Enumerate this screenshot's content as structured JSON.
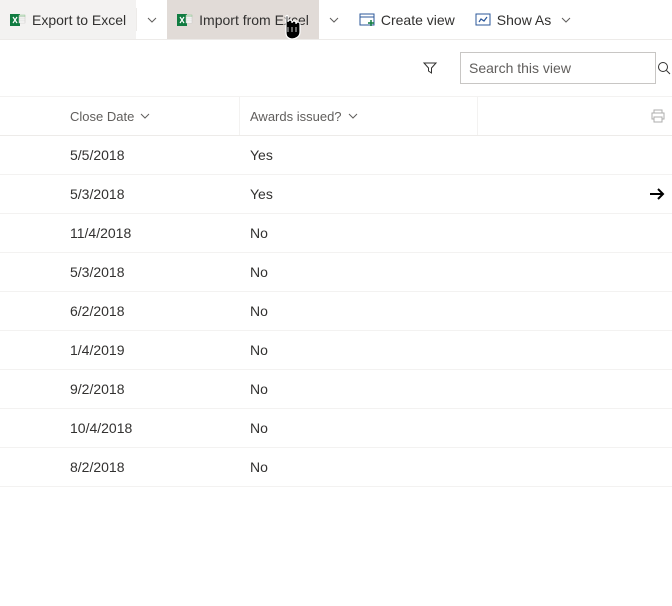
{
  "toolbar": {
    "export_label": "Export to Excel",
    "import_label": "Import from Excel",
    "create_view_label": "Create view",
    "show_as_label": "Show As"
  },
  "search": {
    "placeholder": "Search this view"
  },
  "columns": {
    "close_date": "Close Date",
    "awards_issued": "Awards issued?"
  },
  "rows": [
    {
      "close_date": "5/5/2018",
      "awards_issued": "Yes",
      "arrow": false
    },
    {
      "close_date": "5/3/2018",
      "awards_issued": "Yes",
      "arrow": true
    },
    {
      "close_date": "11/4/2018",
      "awards_issued": "No",
      "arrow": false
    },
    {
      "close_date": "5/3/2018",
      "awards_issued": "No",
      "arrow": false
    },
    {
      "close_date": "6/2/2018",
      "awards_issued": "No",
      "arrow": false
    },
    {
      "close_date": "1/4/2019",
      "awards_issued": "No",
      "arrow": false
    },
    {
      "close_date": "9/2/2018",
      "awards_issued": "No",
      "arrow": false
    },
    {
      "close_date": "10/4/2018",
      "awards_issued": "No",
      "arrow": false
    },
    {
      "close_date": "8/2/2018",
      "awards_issued": "No",
      "arrow": false
    }
  ]
}
